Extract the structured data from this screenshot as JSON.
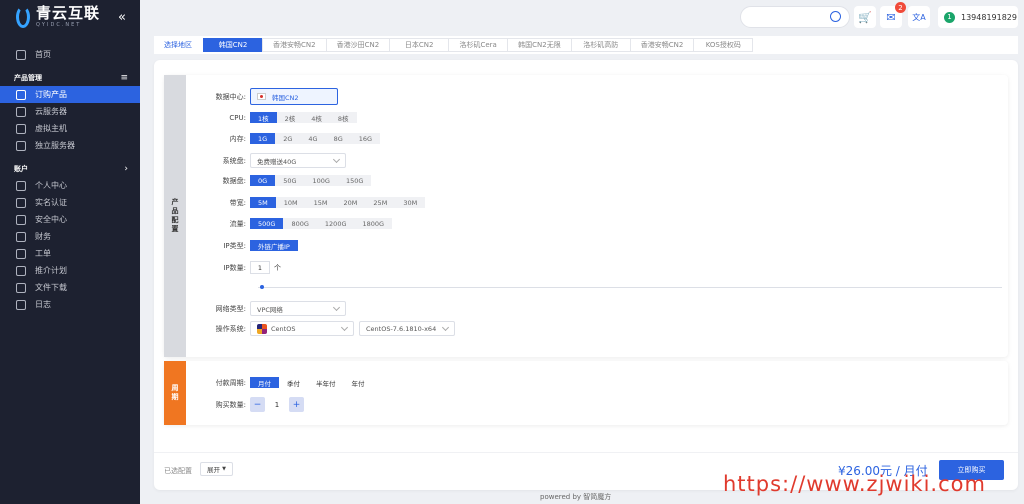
{
  "brand": {
    "name_cn": "青云互联",
    "name_en": "QYIDC.NET",
    "collapse": "«"
  },
  "nav": {
    "home": "首页",
    "group_products": "产品管理",
    "group_products_icon": "≡",
    "items": [
      "订购产品",
      "云服务器",
      "虚拟主机",
      "独立服务器"
    ],
    "group_account": "账户",
    "group_account_icon": "›",
    "account_items": [
      "个人中心",
      "实名认证",
      "安全中心",
      "财务",
      "工单",
      "推介计划",
      "文件下载",
      "日志"
    ]
  },
  "topbar": {
    "cart_badge": "2",
    "phone": "13948191829",
    "avatar": "1",
    "translate_icon": "文A"
  },
  "region": {
    "label": "选择地区",
    "tabs": [
      "韩国CN2",
      "香港安畅CN2",
      "香港沙田CN2",
      "日本CN2",
      "洛杉矶Cera",
      "韩国CN2无限",
      "洛杉矶高防",
      "香港安畅CN2",
      "KOS授权码"
    ],
    "active": 0
  },
  "product_section": "产品配置",
  "config": {
    "datacenter": {
      "label": "数据中心:",
      "value": "韩国CN2"
    },
    "cpu": {
      "label": "CPU:",
      "options": [
        "1核",
        "2核",
        "4核",
        "8核"
      ],
      "active": 0
    },
    "memory": {
      "label": "内存:",
      "options": [
        "1G",
        "2G",
        "4G",
        "8G",
        "16G"
      ],
      "active": 0
    },
    "system_disk": {
      "label": "系统盘:",
      "value": "免费赠送40G"
    },
    "data_disk": {
      "label": "数据盘:",
      "options": [
        "0G",
        "50G",
        "100G",
        "150G"
      ],
      "active": 0
    },
    "bandwidth": {
      "label": "带宽:",
      "options": [
        "5M",
        "10M",
        "15M",
        "20M",
        "25M",
        "30M"
      ],
      "active": 0
    },
    "traffic": {
      "label": "流量:",
      "options": [
        "500G",
        "800G",
        "1200G",
        "1800G"
      ],
      "active": 0
    },
    "ip_type": {
      "label": "IP类型:",
      "options": [
        "外链广播IP"
      ],
      "active": 0
    },
    "ip_count": {
      "label": "IP数量:",
      "value": "1",
      "unit": "个"
    },
    "network": {
      "label": "网络类型:",
      "value": "VPC网络"
    },
    "os": {
      "label": "操作系统:",
      "value": "CentOS",
      "version": "CentOS-7.6.1810-x64"
    }
  },
  "period_section": "周期",
  "period": {
    "label": "付款周期:",
    "options": [
      "月付",
      "季付",
      "半年付",
      "年付"
    ],
    "active": 0,
    "qty_label": "购买数量:",
    "qty": "1",
    "minus": "−",
    "plus": "+"
  },
  "footer": {
    "selected": "已选配置",
    "expand": "展开",
    "price": "¥26.00元 / 月付",
    "buy": "立即购买"
  },
  "powered": "powered by 智简魔方",
  "watermark": "https://www.zjwiki.com",
  "colors": {
    "accent": "#2c63e0",
    "sidebar": "#1d2130",
    "orange": "#f07621"
  }
}
